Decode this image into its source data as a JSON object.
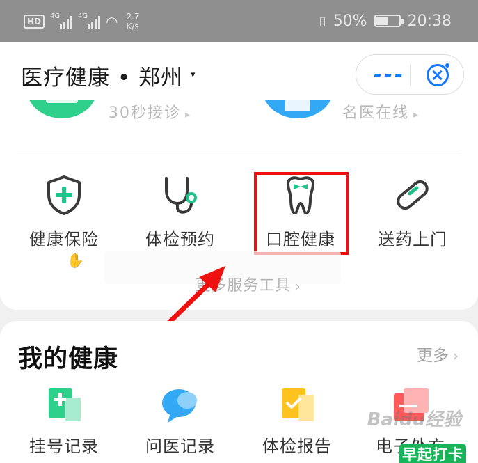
{
  "status_bar": {
    "hd": "HD",
    "sim1": "4G",
    "sim2": "4G",
    "speed_value": "2.7",
    "speed_unit": "K/s",
    "battery_percent": "50%",
    "battery_level": 0.5,
    "time": "20:38"
  },
  "header": {
    "title": "医疗健康 • 郑州",
    "city_arrow": "▾"
  },
  "partial_row": {
    "left_text": "30秒接诊",
    "right_text": "名医在线",
    "chevron": "▸"
  },
  "services": [
    {
      "label": "健康保险",
      "icon": "shield-plus-icon"
    },
    {
      "label": "体检预约",
      "icon": "stethoscope-icon"
    },
    {
      "label": "口腔健康",
      "icon": "tooth-icon"
    },
    {
      "label": "送药上门",
      "icon": "pill-capsule-icon"
    }
  ],
  "more_tools": {
    "label": "更多服务工具",
    "chevron": "›"
  },
  "my_health": {
    "title": "我的健康",
    "more_label": "更多",
    "more_chevron": "›",
    "items": [
      {
        "label": "挂号记录",
        "icon": "registration-record-icon"
      },
      {
        "label": "问医记录",
        "icon": "chat-bubble-icon"
      },
      {
        "label": "体检报告",
        "icon": "checkup-report-icon"
      },
      {
        "label": "电子处方",
        "icon": "prescription-icon"
      }
    ]
  },
  "overlay": {
    "watermark": "Baidu经验",
    "punch_button": "早起打卡"
  },
  "colors": {
    "accent_blue": "#1677ff",
    "accent_green": "#1fc38a",
    "highlight_red": "#ef1010",
    "icon_dark": "#3a3a3a"
  }
}
